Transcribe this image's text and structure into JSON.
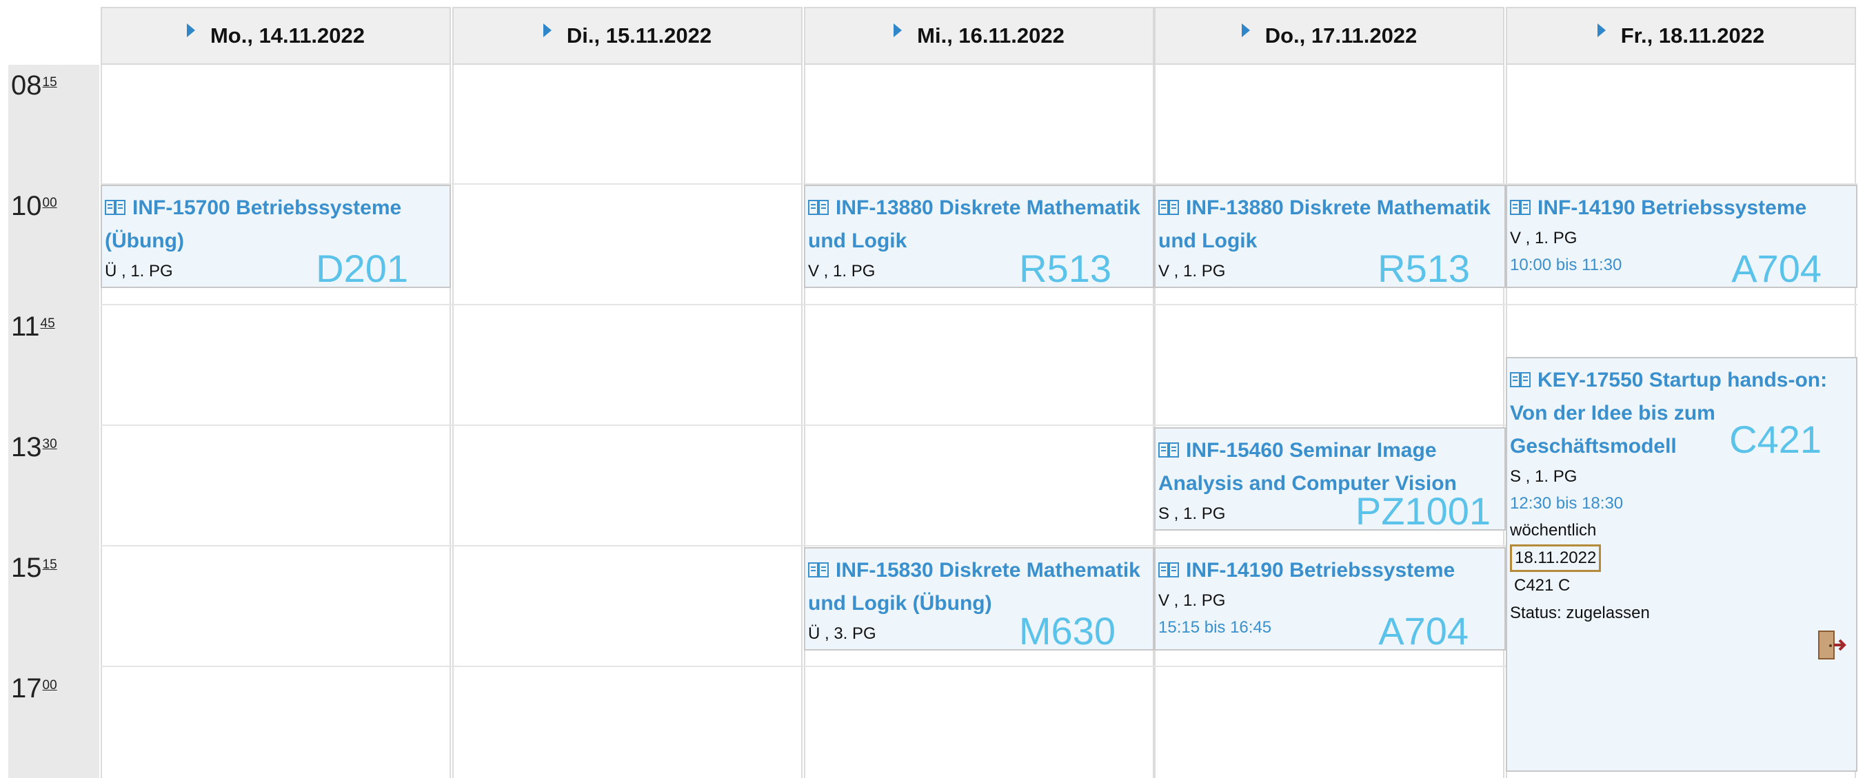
{
  "days": [
    {
      "label": "Mo., 14.11.2022"
    },
    {
      "label": "Di., 15.11.2022"
    },
    {
      "label": "Mi., 16.11.2022"
    },
    {
      "label": "Do., 17.11.2022"
    },
    {
      "label": "Fr., 18.11.2022"
    }
  ],
  "times": [
    {
      "hour": "08",
      "min": "15"
    },
    {
      "hour": "10",
      "min": "00"
    },
    {
      "hour": "11",
      "min": "45"
    },
    {
      "hour": "13",
      "min": "30"
    },
    {
      "hour": "15",
      "min": "15"
    },
    {
      "hour": "17",
      "min": "00"
    }
  ],
  "events": {
    "mon_bs_uebung": {
      "title": "INF-15700 Betriebssysteme (Übung)",
      "meta": "Ü , 1. PG",
      "room": "D201"
    },
    "wed_dml": {
      "title": "INF-13880 Diskrete Mathematik und Logik",
      "meta": "V , 1. PG",
      "room": "R513"
    },
    "thu_dml": {
      "title": "INF-13880 Diskrete Mathematik und Logik",
      "meta": "V , 1. PG",
      "room": "R513"
    },
    "fri_bs": {
      "title": "INF-14190 Betriebssysteme",
      "meta": "V , 1. PG",
      "time": "10:00 bis 11:30",
      "room": "A704"
    },
    "fri_key": {
      "title": "KEY-17550 Startup hands-on: Von der Idee bis zum Geschäftsmodell",
      "meta": "S , 1. PG",
      "time": "12:30 bis 18:30",
      "freq": "wöchentlich",
      "date": "18.11.2022",
      "room_line": "C421  C",
      "status": "Status: zugelassen",
      "room": "C421"
    },
    "thu_seminar": {
      "title": "INF-15460 Seminar Image Analysis and Computer Vision",
      "meta": "S , 1. PG",
      "room": "PZ1001"
    },
    "wed_dml_uebung": {
      "title": "INF-15830 Diskrete Mathematik und Logik (Übung)",
      "meta": "Ü , 3. PG",
      "room": "M630"
    },
    "thu_bs": {
      "title": "INF-14190 Betriebssysteme",
      "meta": "V , 1. PG",
      "time": "15:15 bis 16:45",
      "room": "A704"
    }
  },
  "colors": {
    "link": "#3a8fcd",
    "room": "#5bc2ea",
    "event_bg": "#eef6fc",
    "header_bg": "#efefef",
    "time_bg": "#e9e9e9",
    "date_box_border": "#b58a3a",
    "exit_icon": "#a32a2a"
  },
  "icons": {
    "header_arrow": "chevron-right-icon",
    "event_type": "book-icon",
    "exit": "exit-door-icon"
  }
}
